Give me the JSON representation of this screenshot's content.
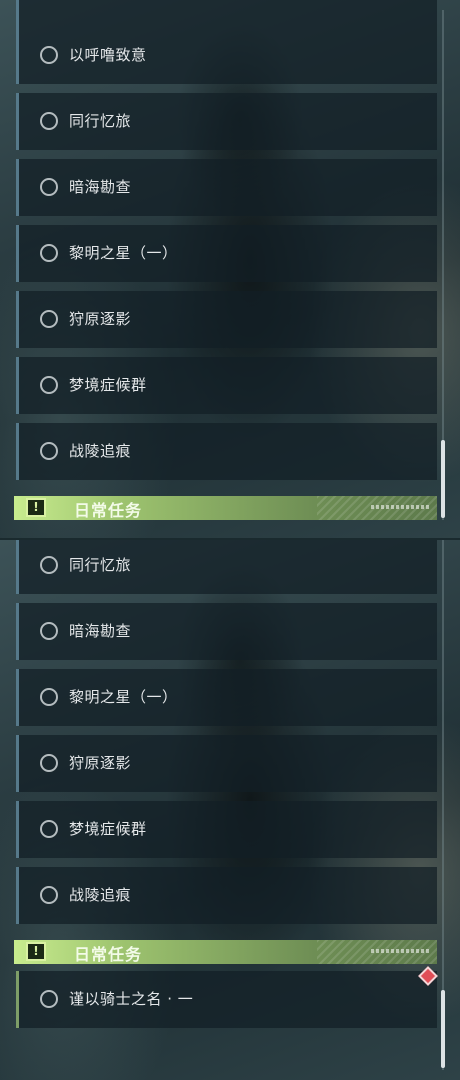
{
  "upper_list": {
    "items": [
      {
        "label": ""
      },
      {
        "label": "以呼噜致意"
      },
      {
        "label": "同行忆旅"
      },
      {
        "label": "暗海勘查"
      },
      {
        "label": "黎明之星（一）"
      },
      {
        "label": "狩原逐影"
      },
      {
        "label": "梦境症候群"
      },
      {
        "label": "战陵追痕"
      }
    ],
    "section_header": {
      "title": "日常任务",
      "badge": "!"
    }
  },
  "lower_list": {
    "items": [
      {
        "label": "同行忆旅"
      },
      {
        "label": "暗海勘查"
      },
      {
        "label": "黎明之星（一）"
      },
      {
        "label": "狩原逐影"
      },
      {
        "label": "梦境症候群"
      },
      {
        "label": "战陵追痕"
      }
    ],
    "section_header": {
      "title": "日常任务",
      "badge": "!"
    },
    "daily_items": [
      {
        "label": "谨以骑士之名 · 一"
      }
    ]
  },
  "colors": {
    "header_accent": "#9ec46f",
    "card_border": "#56798a",
    "daily_card_border": "#7e9e68",
    "notification_diamond": "#e04e57"
  }
}
